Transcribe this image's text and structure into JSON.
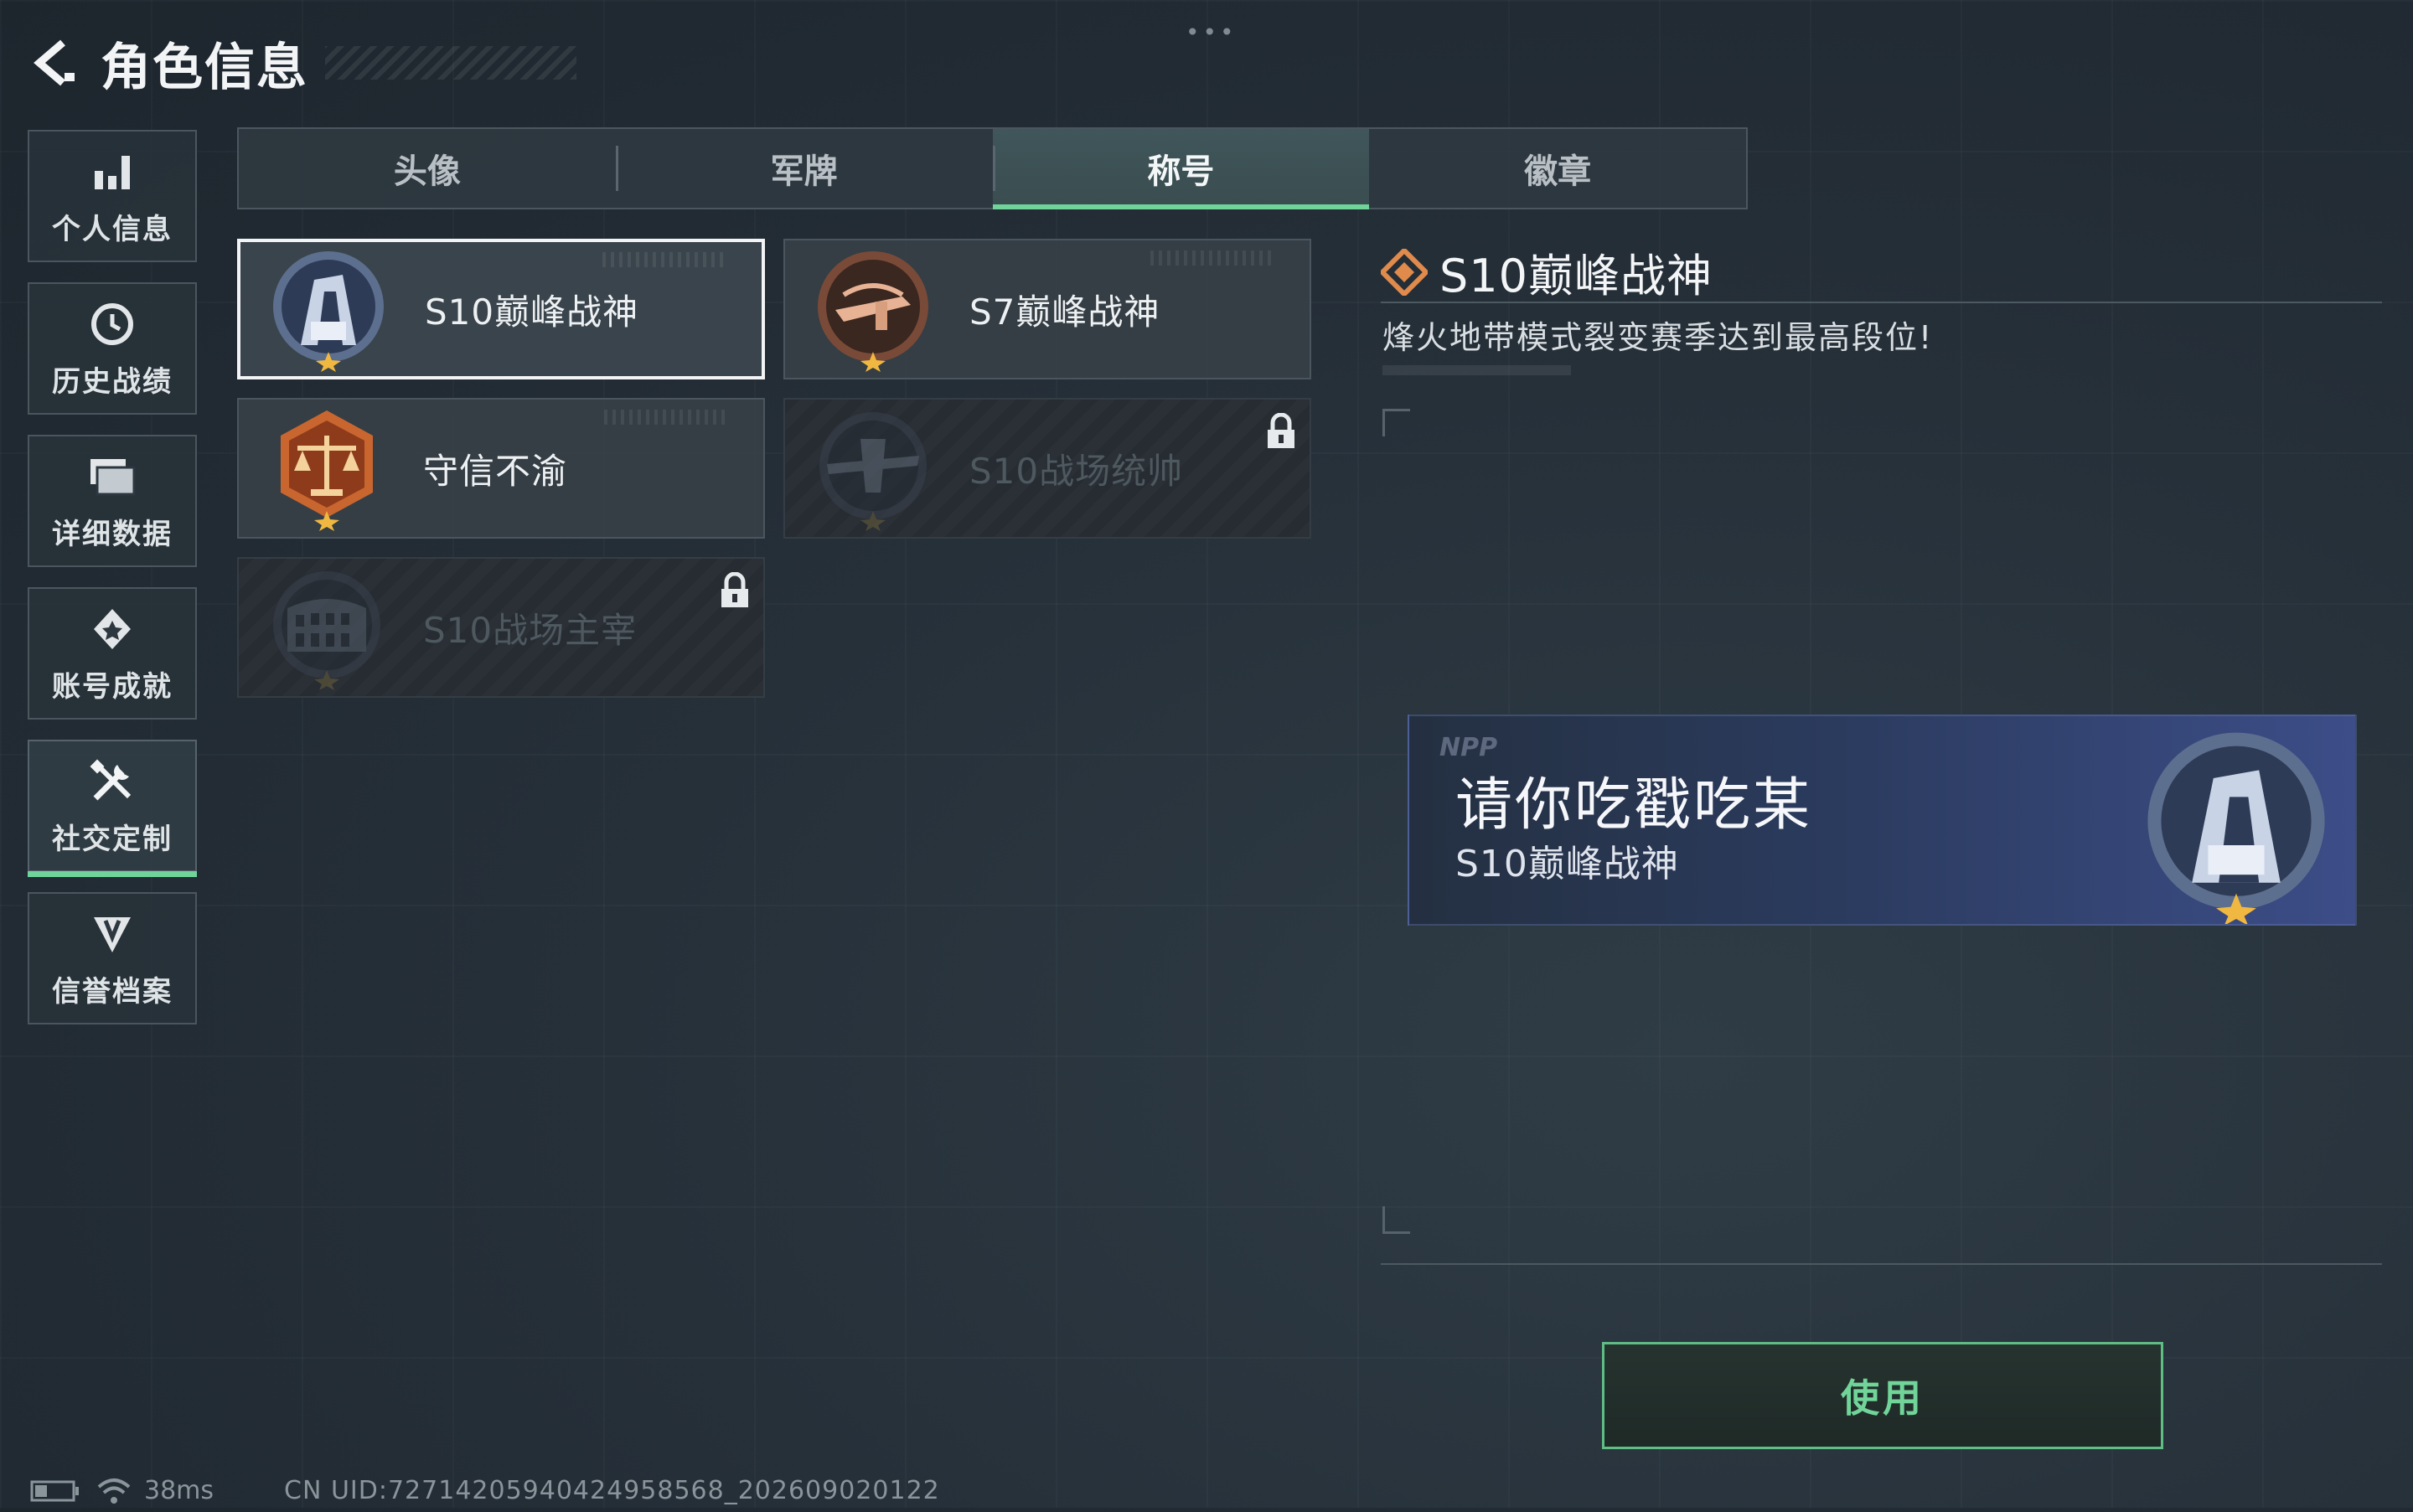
{
  "header": {
    "title": "角色信息"
  },
  "sidebar": {
    "items": [
      {
        "label": "个人信息",
        "icon": "bar-chart-icon"
      },
      {
        "label": "历史战绩",
        "icon": "history-clock-icon"
      },
      {
        "label": "详细数据",
        "icon": "folder-data-icon"
      },
      {
        "label": "账号成就",
        "icon": "achievement-icon"
      },
      {
        "label": "社交定制",
        "icon": "tools-icon",
        "active": true
      },
      {
        "label": "信誉档案",
        "icon": "reputation-icon"
      }
    ]
  },
  "tabs": [
    {
      "label": "头像"
    },
    {
      "label": "军牌"
    },
    {
      "label": "称号",
      "active": true
    },
    {
      "label": "徽章"
    }
  ],
  "titles": [
    {
      "label": "S10巅峰战神",
      "selected": true,
      "locked": false,
      "medal": "peak-war-god-medal-icon"
    },
    {
      "label": "S7巅峰战神",
      "selected": false,
      "locked": false,
      "medal": "s7-war-god-medal-icon"
    },
    {
      "label": "守信不渝",
      "selected": false,
      "locked": false,
      "medal": "scales-medal-icon"
    },
    {
      "label": "S10战场统帅",
      "selected": false,
      "locked": true,
      "medal": "aircraft-medal-icon"
    },
    {
      "label": "S10战场主宰",
      "selected": false,
      "locked": true,
      "medal": "colosseum-medal-icon"
    }
  ],
  "detail": {
    "title": "S10巅峰战神",
    "description": "烽火地带模式裂变赛季达到最高段位!"
  },
  "preview": {
    "logo": "NPP",
    "player_name": "请你吃戳吃某",
    "title": "S10巅峰战神"
  },
  "actions": {
    "use_label": "使用"
  },
  "status": {
    "ping": "38ms",
    "uid": "CN UID:7271420594042495856​8_202609020122"
  },
  "colors": {
    "accent": "#6fd39a",
    "medal_orange": "#e08a4c"
  }
}
